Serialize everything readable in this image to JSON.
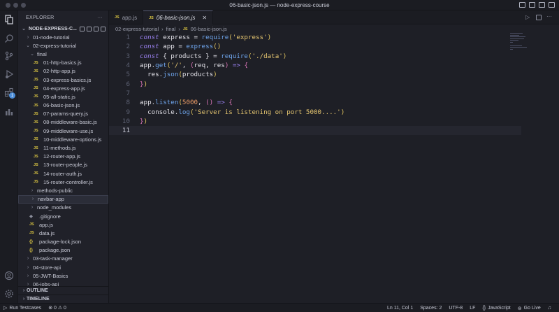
{
  "window": {
    "title": "06-basic-json.js — node-express-course"
  },
  "activity_bar": {
    "badge": "1"
  },
  "sidebar": {
    "header": "EXPLORER",
    "project": "NODE-EXPRESS-C...",
    "items": [
      {
        "label": "01-node-tutorial",
        "type": "folder",
        "indent": 1,
        "open": false
      },
      {
        "label": "02-express-tutorial",
        "type": "folder",
        "indent": 1,
        "open": true
      },
      {
        "label": "final",
        "type": "folder",
        "indent": 2,
        "open": true
      },
      {
        "label": "01-http-basics.js",
        "type": "js",
        "indent": 3
      },
      {
        "label": "02-http-app.js",
        "type": "js",
        "indent": 3
      },
      {
        "label": "03-express-basics.js",
        "type": "js",
        "indent": 3
      },
      {
        "label": "04-express-app.js",
        "type": "js",
        "indent": 3
      },
      {
        "label": "05-all-static.js",
        "type": "js",
        "indent": 3
      },
      {
        "label": "06-basic-json.js",
        "type": "js",
        "indent": 3
      },
      {
        "label": "07-params-query.js",
        "type": "js",
        "indent": 3
      },
      {
        "label": "08-middleware-basic.js",
        "type": "js",
        "indent": 3
      },
      {
        "label": "09-middleware-use.js",
        "type": "js",
        "indent": 3
      },
      {
        "label": "10-middleware-options.js",
        "type": "js",
        "indent": 3
      },
      {
        "label": "11-methods.js",
        "type": "js",
        "indent": 3
      },
      {
        "label": "12-router-app.js",
        "type": "js",
        "indent": 3
      },
      {
        "label": "13-router-people.js",
        "type": "js",
        "indent": 3
      },
      {
        "label": "14-router-auth.js",
        "type": "js",
        "indent": 3
      },
      {
        "label": "15-router-controller.js",
        "type": "js",
        "indent": 3
      },
      {
        "label": "methods-public",
        "type": "folder",
        "indent": 2,
        "open": false
      },
      {
        "label": "navbar-app",
        "type": "folder",
        "indent": 2,
        "open": false,
        "selected": true
      },
      {
        "label": "node_modules",
        "type": "folder",
        "indent": 2,
        "open": false
      },
      {
        "label": ".gitignore",
        "type": "git",
        "indent": 2
      },
      {
        "label": "app.js",
        "type": "js",
        "indent": 2
      },
      {
        "label": "data.js",
        "type": "js",
        "indent": 2
      },
      {
        "label": "package-lock.json",
        "type": "json",
        "indent": 2
      },
      {
        "label": "package.json",
        "type": "json",
        "indent": 2
      },
      {
        "label": "03-task-manager",
        "type": "folder",
        "indent": 1,
        "open": false
      },
      {
        "label": "04-store-api",
        "type": "folder",
        "indent": 1,
        "open": false
      },
      {
        "label": "05-JWT-Basics",
        "type": "folder",
        "indent": 1,
        "open": false
      },
      {
        "label": "06-jobs-api",
        "type": "folder",
        "indent": 1,
        "open": false
      }
    ],
    "outline": "OUTLINE",
    "timeline": "TIMELINE"
  },
  "tabs": [
    {
      "label": "app.js",
      "active": false
    },
    {
      "label": "06-basic-json.js",
      "active": true,
      "close": "✕"
    }
  ],
  "breadcrumb": [
    "02-express-tutorial",
    "final",
    "06-basic-json.js"
  ],
  "editor": {
    "current_line": 11,
    "lines": [
      [
        [
          "kw",
          "const"
        ],
        [
          "id",
          " express "
        ],
        [
          "pn",
          "= "
        ],
        [
          "fn",
          "require"
        ],
        [
          "br",
          "("
        ],
        [
          "str",
          "'express'"
        ],
        [
          "br",
          ")"
        ]
      ],
      [
        [
          "kw",
          "const"
        ],
        [
          "id",
          " app "
        ],
        [
          "pn",
          "= "
        ],
        [
          "fn",
          "express"
        ],
        [
          "br",
          "()"
        ]
      ],
      [
        [
          "kw",
          "const"
        ],
        [
          "pn",
          " { "
        ],
        [
          "id",
          "products"
        ],
        [
          "pn",
          " } = "
        ],
        [
          "fn",
          "require"
        ],
        [
          "br",
          "("
        ],
        [
          "str",
          "'./data'"
        ],
        [
          "br",
          ")"
        ]
      ],
      [
        [
          "id",
          "app"
        ],
        [
          "pn",
          "."
        ],
        [
          "fn",
          "get"
        ],
        [
          "br",
          "("
        ],
        [
          "str",
          "'/'"
        ],
        [
          "pn",
          ", "
        ],
        [
          "br2",
          "("
        ],
        [
          "id",
          "req, res"
        ],
        [
          "br2",
          ")"
        ],
        [
          "kw",
          " =>"
        ],
        [
          "br2",
          " {"
        ]
      ],
      [
        [
          "id",
          "  res"
        ],
        [
          "pn",
          "."
        ],
        [
          "fn",
          "json"
        ],
        [
          "br",
          "("
        ],
        [
          "id",
          "products"
        ],
        [
          "br",
          ")"
        ]
      ],
      [
        [
          "br2",
          "}"
        ],
        [
          "br",
          ")"
        ]
      ],
      [],
      [
        [
          "id",
          "app"
        ],
        [
          "pn",
          "."
        ],
        [
          "fn",
          "listen"
        ],
        [
          "br",
          "("
        ],
        [
          "num2",
          "5000"
        ],
        [
          "pn",
          ", "
        ],
        [
          "br2",
          "()"
        ],
        [
          "kw",
          " =>"
        ],
        [
          "br2",
          " {"
        ]
      ],
      [
        [
          "id",
          "  console"
        ],
        [
          "pn",
          "."
        ],
        [
          "fn",
          "log"
        ],
        [
          "br",
          "("
        ],
        [
          "str",
          "'Server is listening on port 5000....'"
        ],
        [
          "br",
          ")"
        ]
      ],
      [
        [
          "br2",
          "}"
        ],
        [
          "br",
          ")"
        ]
      ],
      []
    ]
  },
  "status": {
    "run": "Run Testcases",
    "problems": "⊗ 0 ⚠ 0",
    "position": "Ln 11, Col 1",
    "spaces": "Spaces: 2",
    "encoding": "UTF-8",
    "eol": "LF",
    "language": "JavaScript",
    "golive": "Go Live"
  }
}
